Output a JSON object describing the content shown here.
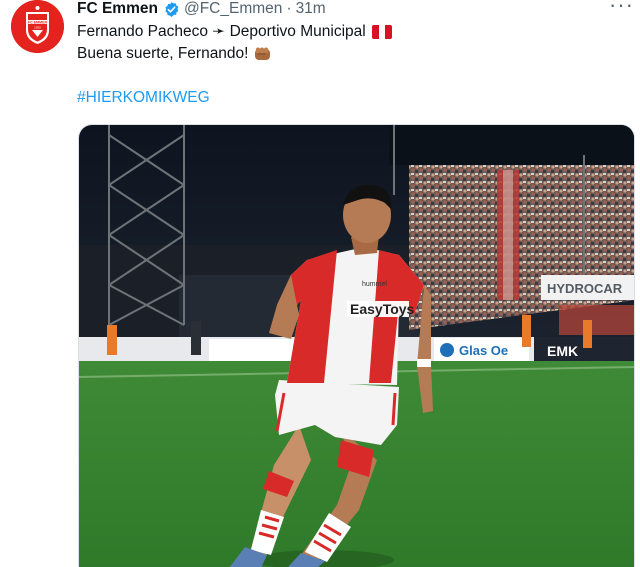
{
  "tweet": {
    "display_name": "FC Emmen",
    "handle": "@FC_Emmen",
    "separator": "·",
    "time": "31m",
    "more_label": "···",
    "line1": "Fernando Pacheco ➛ Deportivo Municipal",
    "line2": "Buena suerte, Fernando!",
    "hashtag": "#HIERKOMIKWEG",
    "avatar_text": "FC EMMEN",
    "avatar_year": "1925"
  },
  "photo": {
    "sponsor_shirt": "EasyToys",
    "board_hydrocar": "HYDROCAR",
    "board_glas": "Glas  Oe",
    "board_emk": "EMK",
    "board_hummel": "hummel"
  },
  "icons": {
    "verified": "verified-badge-icon",
    "flag": "peru-flag-icon",
    "fist": "oncoming-fist-icon",
    "more": "more-options-icon"
  },
  "colors": {
    "brand_red": "#e4231f",
    "link_blue": "#1d9bf0",
    "muted_gray": "#536471",
    "text_dark": "#0f1419"
  }
}
